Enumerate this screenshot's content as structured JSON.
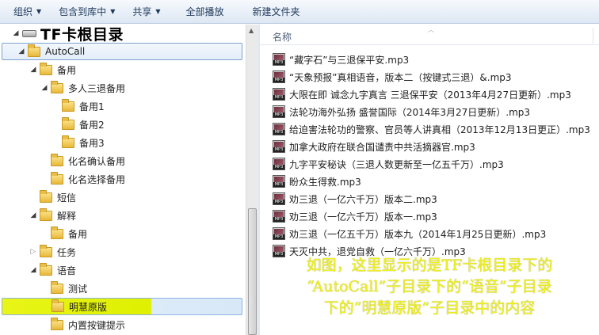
{
  "toolbar": {
    "items": [
      {
        "label": "组织",
        "has_menu": true
      },
      {
        "label": "包含到库中",
        "has_menu": true
      },
      {
        "label": "共享",
        "has_menu": true
      },
      {
        "label": "全部播放",
        "has_menu": false
      },
      {
        "label": "新建文件夹",
        "has_menu": false
      }
    ]
  },
  "nav": {
    "items": [
      {
        "label": "TF卡根目录",
        "icon": "drive-icon",
        "expander": "expanded"
      },
      {
        "label": "AutoCall",
        "icon": "folder-icon",
        "expander": "expanded",
        "state": "hover"
      },
      {
        "label": "备用",
        "icon": "folder-icon",
        "expander": "expanded"
      },
      {
        "label": "多人三退备用",
        "icon": "folder-icon",
        "expander": "expanded"
      },
      {
        "label": "备用1",
        "icon": "folder-icon",
        "expander": "none"
      },
      {
        "label": "备用2",
        "icon": "folder-icon",
        "expander": "none"
      },
      {
        "label": "备用3",
        "icon": "folder-icon",
        "expander": "none"
      },
      {
        "label": "化名确认备用",
        "icon": "folder-icon",
        "expander": "none"
      },
      {
        "label": "化名选择备用",
        "icon": "folder-icon",
        "expander": "none"
      },
      {
        "label": "短信",
        "icon": "folder-icon",
        "expander": "none"
      },
      {
        "label": "解释",
        "icon": "folder-icon",
        "expander": "expanded"
      },
      {
        "label": "备用",
        "icon": "folder-icon",
        "expander": "none"
      },
      {
        "label": "任务",
        "icon": "folder-icon",
        "expander": "collapsed"
      },
      {
        "label": "语音",
        "icon": "folder-icon",
        "expander": "expanded"
      },
      {
        "label": "测试",
        "icon": "folder-icon",
        "expander": "none"
      },
      {
        "label": "明慧原版",
        "icon": "folder-icon",
        "expander": "none",
        "state": "selected"
      },
      {
        "label": "内置按键提示",
        "icon": "folder-icon",
        "expander": "none"
      }
    ]
  },
  "content": {
    "column_header": "名称",
    "files": [
      "“藏字石”与三退保平安.mp3",
      "“天象预报”真相语音，版本二（按键式三退）&.mp3",
      "大限在即 诚念九字真言 三退保平安（2013年4月27日更新）.mp3",
      "法轮功海外弘扬 盛誉国际（2014年3月27日更新）.mp3",
      "给迫害法轮功的警察、官员等人讲真相（2013年12月13日更正）.mp3",
      "加拿大政府在联合国谴责中共活摘器官.mp3",
      "九字平安秘诀（三退人数更新至一亿五千万）.mp3",
      "盼众生得救.mp3",
      "劝三退（一亿六千万）版本二.mp3",
      "劝三退（一亿六千万）版本一.mp3",
      "劝三退（一亿五千万）版本九（2014年1月25日更新）.mp3",
      "天灭中共，退党自救（一亿六千万）.mp3"
    ]
  },
  "annotation": {
    "lines": [
      "如图，这里显示的是TF卡根目录下的",
      "“AutoCall”子目录下的“语音”子目录",
      "下的“明慧原版”子目录中的内容"
    ],
    "color": "#f0f21e"
  },
  "colors": {
    "toolbar_text": "#1e395b",
    "selection_highlight": "#e8f518",
    "hover_border": "#7da2ce"
  }
}
